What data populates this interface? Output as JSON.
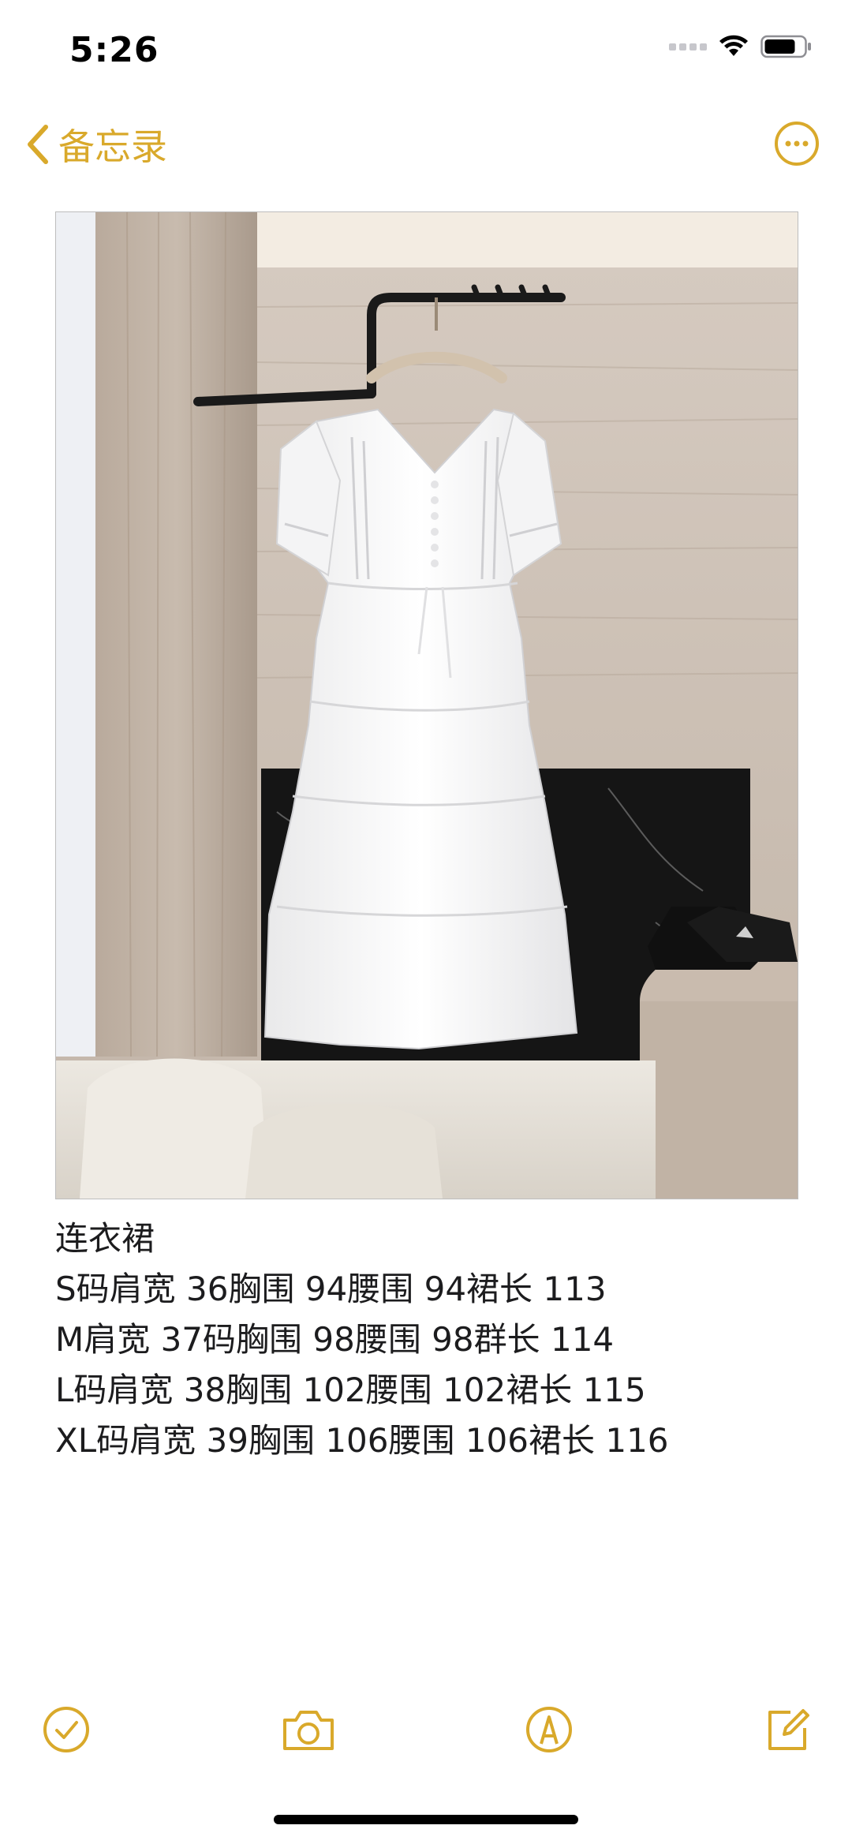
{
  "status_bar": {
    "time": "5:26"
  },
  "nav": {
    "back_label": "备忘录"
  },
  "note": {
    "lines": [
      "连衣裙",
      "S码肩宽 36胸围 94腰围 94裙长 113",
      "M肩宽 37码胸围 98腰围 98群长 114",
      "L码肩宽 38胸围 102腰围 102裙长 115",
      "XL码肩宽 39胸围 106腰围 106裙长 116"
    ]
  },
  "toolbar": {
    "items": [
      "checklist-icon",
      "camera-icon",
      "markup-icon",
      "compose-icon"
    ]
  },
  "colors": {
    "accent": "#d9a92b",
    "text": "#1c1c1e",
    "background": "#ffffff"
  }
}
